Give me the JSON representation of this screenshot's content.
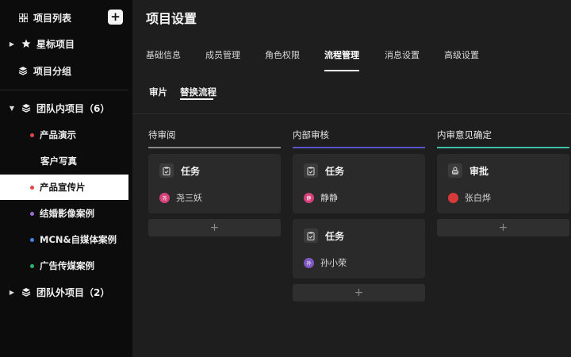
{
  "sidebar": {
    "project_list": "项目列表",
    "add_symbol": "+",
    "starred": "星标项目",
    "groups": "项目分组",
    "team_inner": "团队内项目（6）",
    "sub_items": [
      {
        "label": "产品演示",
        "dot": "#e04646"
      },
      {
        "label": "客户写真",
        "dot": ""
      },
      {
        "label": "产品宣传片",
        "dot": "#e04646"
      },
      {
        "label": "结婚影像案例",
        "dot": "#9b6bd6"
      },
      {
        "label": "MCN&自媒体案例",
        "dot": "#3e86e8"
      },
      {
        "label": "广告传媒案例",
        "dot": "#2bb673"
      }
    ],
    "team_outer": "团队外项目（2）"
  },
  "page_title": "项目设置",
  "tabs": [
    "基础信息",
    "成员管理",
    "角色权限",
    "流程管理",
    "消息设置",
    "高级设置"
  ],
  "active_tab": "流程管理",
  "sub_tabs": [
    "审片",
    "替换流程"
  ],
  "active_sub_tab": "替换流程",
  "columns": [
    {
      "title": "待审阅",
      "color": "#8a8a8a",
      "cards": [
        {
          "label": "任务",
          "icon": "clipboard-icon",
          "person": "尧三妖",
          "avatar_color": "#d6407a",
          "avatar_text": "尧"
        }
      ]
    },
    {
      "title": "内部审核",
      "color": "#5a55c8",
      "cards": [
        {
          "label": "任务",
          "icon": "clipboard-icon",
          "person": "静静",
          "avatar_color": "#d6407a",
          "avatar_text": "静"
        },
        {
          "label": "任务",
          "icon": "clipboard-icon",
          "person": "孙小荣",
          "avatar_color": "#7e57c2",
          "avatar_text": "孙"
        }
      ]
    },
    {
      "title": "内审意见确定",
      "color": "#3fbfa8",
      "cards": [
        {
          "label": "审批",
          "icon": "stamp-icon",
          "person": "张白烨",
          "avatar_color": "#d63a3a",
          "avatar_text": ""
        }
      ]
    }
  ],
  "add_symbol": "+"
}
